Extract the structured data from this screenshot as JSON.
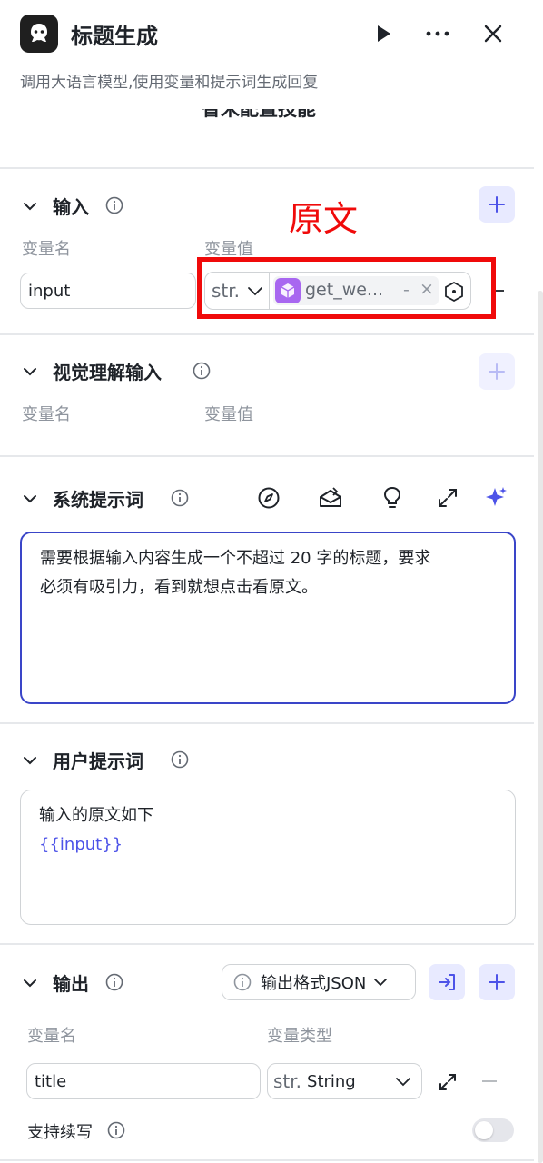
{
  "header": {
    "title": "标题生成",
    "description": "调用大语言模型,使用变量和提示词生成回复",
    "cut_off_text": "智米配置技能"
  },
  "input_section": {
    "title": "输入",
    "col_name": "变量名",
    "col_value": "变量值",
    "row": {
      "name": "input",
      "type_prefix": "str.",
      "ref_value": "get_we...",
      "ref_dash": "-",
      "ref_close": "×"
    }
  },
  "annotation": {
    "text": "原文",
    "color": "#f00a0a"
  },
  "vision_section": {
    "title": "视觉理解输入",
    "col_name": "变量名",
    "col_value": "变量值"
  },
  "system_prompt": {
    "title": "系统提示词",
    "text_line1": "需要根据输入内容生成一个不超过 20 字的标题，要求",
    "text_line2": "必须有吸引力，看到就想点击看原文。"
  },
  "user_prompt": {
    "title": "用户提示词",
    "text_line1": "输入的原文如下",
    "var_token": "{{input}}"
  },
  "output_section": {
    "title": "输出",
    "format_label": "输出格式JSON",
    "col_name": "变量名",
    "col_type": "变量类型",
    "row": {
      "name": "title",
      "type_prefix": "str.",
      "type_label": "String"
    },
    "continue_label": "支持续写",
    "continue_enabled": false
  },
  "colors": {
    "accent": "#4d53e8",
    "accent_bg": "#e8eaff",
    "purple_tag": "#a867f0",
    "border_focus": "#3a45c8"
  }
}
